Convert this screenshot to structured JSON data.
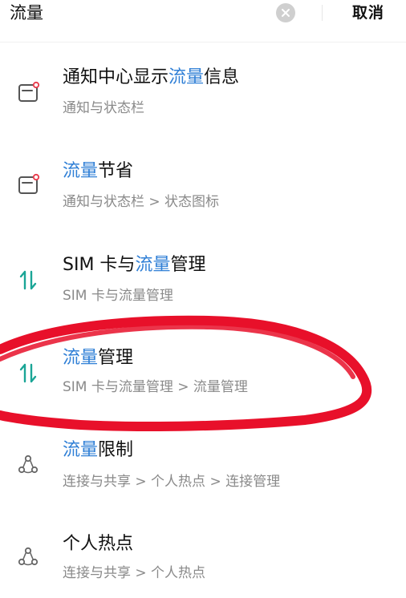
{
  "search": {
    "query": "流量",
    "cancel_label": "取消"
  },
  "results": [
    {
      "icon": "notification-panel-icon",
      "title_pre": "通知中心显示",
      "title_hl": "流量",
      "title_post": "信息",
      "path": "通知与状态栏"
    },
    {
      "icon": "notification-panel-icon",
      "title_pre": "",
      "title_hl": "流量",
      "title_post": "节省",
      "path": "通知与状态栏 > 状态图标"
    },
    {
      "icon": "data-transfer-icon",
      "title_pre": "SIM 卡与",
      "title_hl": "流量",
      "title_post": "管理",
      "path": "SIM 卡与流量管理"
    },
    {
      "icon": "data-transfer-icon",
      "title_pre": "",
      "title_hl": "流量",
      "title_post": "管理",
      "path": "SIM 卡与流量管理 > 流量管理"
    },
    {
      "icon": "connection-share-icon",
      "title_pre": "",
      "title_hl": "流量",
      "title_post": "限制",
      "path": "连接与共享 > 个人热点 > 连接管理"
    },
    {
      "icon": "connection-share-icon",
      "title_pre": "个人热点",
      "title_hl": "",
      "title_post": "",
      "path": "连接与共享 > 个人热点"
    }
  ],
  "colors": {
    "highlight": "#2f7fd6",
    "annotation": "#e8102a",
    "transfer_icon": "#1aa596",
    "notify_dot": "#e8394a"
  }
}
